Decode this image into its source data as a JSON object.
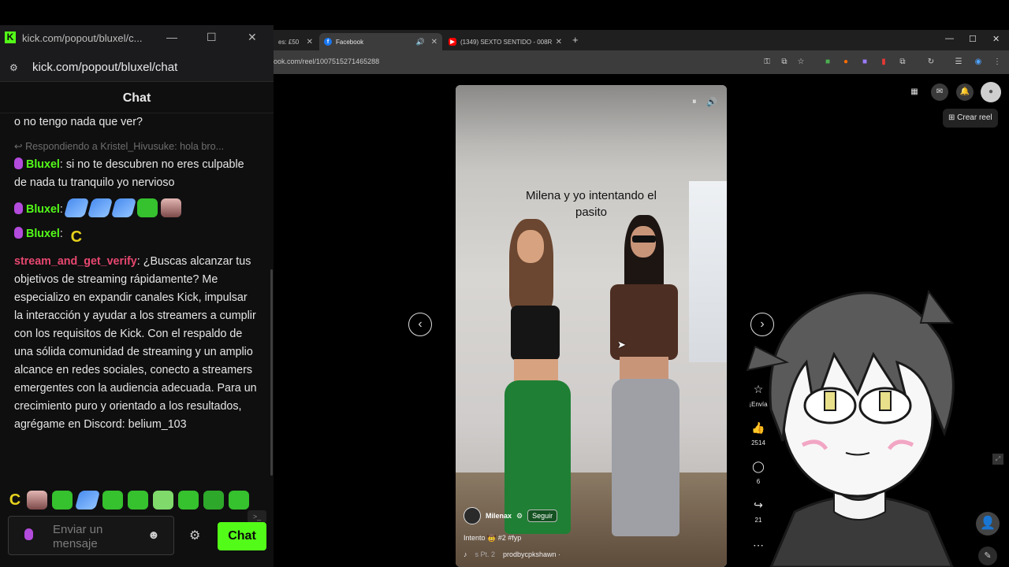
{
  "browser": {
    "tabs": [
      {
        "title": "es: £50"
      },
      {
        "title": "Facebook"
      },
      {
        "title": "(1349) SEXTO SENTIDO - 008R"
      }
    ],
    "url": "ook.com/reel/1007515271465288"
  },
  "fb": {
    "create_reel_label": "Crear reel"
  },
  "reel": {
    "caption_line1": "Milena y yo intentando el",
    "caption_line2": "pasito",
    "author": "Milenax",
    "follow_label": "Seguir",
    "description": "Intento 🤠 #2 #fyp",
    "audio_part": "s Pt. 2",
    "audio_author": "prodbycpkshawn ·",
    "actions": {
      "send_label": "¡Envía",
      "likes": "2514",
      "comments": "6",
      "shares": "21"
    }
  },
  "kick": {
    "window_title": "kick.com/popout/bluxel/c...",
    "url": "kick.com/popout/bluxel/chat",
    "chat_title": "Chat",
    "input_placeholder": "Enviar un mensaje",
    "send_label": "Chat",
    "colors": {
      "accent": "#53fc18",
      "mention": "#e8476f"
    }
  },
  "chat": {
    "m0_text": "o no tengo nada que ver?",
    "m1_reply": "Respondiendo a Kristel_Hivusuke: hola bro...",
    "m1_user": "Bluxel",
    "m1_text": ": si no te descubren no eres culpable de nada tu tranquilo yo nervioso",
    "m2_user": "Bluxel",
    "m3_user": "Bluxel",
    "m4_user": "stream_and_get_verify",
    "m4_text": ": ¿Buscas alcanzar tus objetivos de streaming rápidamente? Me especializo en expandir canales Kick, impulsar la interacción y ayudar a los streamers a cumplir con los requisitos de Kick. Con el respaldo de una sólida comunidad de streaming y un amplio alcance en redes sociales, conecto a streamers emergentes con la audiencia adecuada. Para un crecimiento puro y orientado a los resultados, agrégame en Discord: belium_103"
  }
}
